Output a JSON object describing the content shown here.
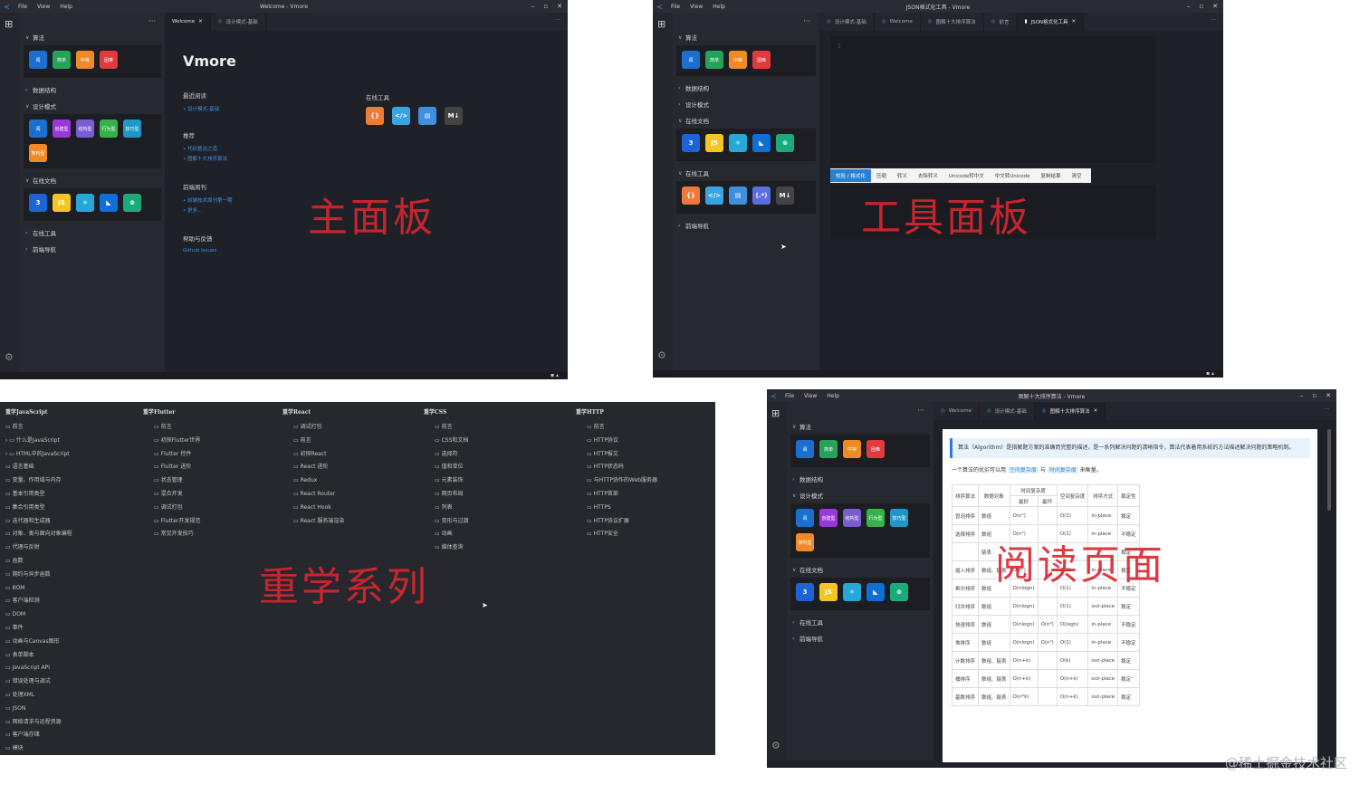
{
  "sidebar": {
    "sections": {
      "algo": "算法",
      "ds": "数据结构",
      "design": "设计模式",
      "docs": "在线文档",
      "tools": "在线工具",
      "nav": "前端导航"
    }
  },
  "algo_icons": [
    {
      "label": "阅",
      "color": "#1a6fcf"
    },
    {
      "label": "简单",
      "color": "#25a35a"
    },
    {
      "label": "中等",
      "color": "#f08a24"
    },
    {
      "label": "困难",
      "color": "#e0393e"
    }
  ],
  "design_icons": [
    {
      "label": "阅",
      "color": "#1a6fcf"
    },
    {
      "label": "创建型",
      "color": "#9b38d9"
    },
    {
      "label": "结构型",
      "color": "#7a5bd0"
    },
    {
      "label": "行为型",
      "color": "#35b34a"
    },
    {
      "label": "技巧型",
      "color": "#2196c9"
    },
    {
      "label": "架构型",
      "color": "#f08a24"
    }
  ],
  "doc_icons": [
    {
      "label": "css3-icon",
      "glyph": "3",
      "color": "#1d63d8"
    },
    {
      "label": "js-icon",
      "glyph": "JS",
      "color": "#f3c623"
    },
    {
      "label": "react-icon",
      "glyph": "⚛",
      "color": "#23a8d8"
    },
    {
      "label": "flutter-icon",
      "glyph": "◣",
      "color": "#0f6fd6"
    },
    {
      "label": "vue-icon",
      "glyph": "⊚",
      "color": "#1bab7a"
    }
  ],
  "tool_icons": [
    {
      "label": "json-icon",
      "glyph": "{}",
      "color": "#f07a3a"
    },
    {
      "label": "code-icon",
      "glyph": "</>",
      "color": "#3aa3e0"
    },
    {
      "label": "doc-icon",
      "glyph": "▤",
      "color": "#3d8fe0"
    },
    {
      "label": "regex-icon",
      "glyph": "(.*)",
      "color": "#5a6ee0"
    },
    {
      "label": "markdown-icon",
      "glyph": "M↓",
      "color": "#444"
    }
  ],
  "win1": {
    "title": "Welcome - Vmore",
    "menu": [
      "File",
      "View",
      "Help"
    ],
    "tabs": [
      "Welcome",
      "设计模式-基础"
    ],
    "app_name": "Vmore",
    "recent_title": "最近阅读",
    "recent": [
      "设计模式-基础"
    ],
    "recommend_title": "推荐",
    "recommend": [
      "代码整洁之道",
      "图解十大排序算法"
    ],
    "periodical_title": "前端周刊",
    "periodical": [
      "前端技术周刊第一期",
      "更多..."
    ],
    "help_title": "帮助与反馈",
    "help": [
      "Github Issues"
    ],
    "tools_title": "在线工具",
    "stamp": "主面板"
  },
  "win2": {
    "title": "JSON格式化工具 - Vmore",
    "tabs": [
      "设计模式-基础",
      "Welcome",
      "图解十大排序算法",
      "前言",
      "JSON格式化工具"
    ],
    "line_no": "1",
    "toolbar": [
      "校验 / 格式化",
      "压缩",
      "转义",
      "去除转义",
      "Unicode转中文",
      "中文转Unicode",
      "复制结果",
      "清空"
    ],
    "stamp": "工具面板"
  },
  "win3": {
    "stamp": "重学系列",
    "columns": [
      {
        "title": "重学JavaScript",
        "items": [
          "前言",
          "什么是JavaScript",
          "HTML中的JavaScript",
          "语言基础",
          "变量、作用域与内存",
          "基本引用类型",
          "集合引用类型",
          "迭代器和生成器",
          "对象、类与面向对象编程",
          "代理与反射",
          "函数",
          "期约与异步函数",
          "BOM",
          "客户端检测",
          "DOM",
          "事件",
          "动画与Canvas图形",
          "表单脚本",
          "JavaScript API",
          "错误处理与调试",
          "处理XML",
          "JSON",
          "网络请求与远程资源",
          "客户端存储",
          "模块"
        ]
      },
      {
        "title": "重学Flutter",
        "items": [
          "前言",
          "初探Flutter世界",
          "Flutter 控件",
          "Flutter 进阶",
          "状态管理",
          "混合开发",
          "调试打包",
          "Flutter开发规范",
          "常见开发技巧"
        ]
      },
      {
        "title": "重学React",
        "items": [
          "调试打包",
          "前言",
          "初探React",
          "React 进阶",
          "Redux",
          "React Router",
          "React Hook",
          "React 服务端渲染"
        ]
      },
      {
        "title": "重学CSS",
        "items": [
          "前言",
          "CSS和文档",
          "选择符",
          "值和单位",
          "元素装饰",
          "网页布局",
          "列表",
          "变形与过渡",
          "动画",
          "媒体查询"
        ]
      },
      {
        "title": "重学HTTP",
        "items": [
          "前言",
          "HTTP协议",
          "HTTP报文",
          "HTTP状态码",
          "与HTTP协作的Web服务器",
          "HTTP首部",
          "HTTPS",
          "HTTP协议扩展",
          "HTTP安全"
        ]
      }
    ]
  },
  "win4": {
    "title": "图解十大排序算法 - Vmore",
    "tabs": [
      "Welcome",
      "设计模式-基础",
      "图解十大排序算法"
    ],
    "intro": "算法（Algorithm）是指解题方案的准确而完整的描述，是一系列解决问题的清晰指令，算法代表着用系统的方法描述解决问题的策略机制。",
    "p_pre": "一个算法的优劣可以用",
    "p_link1": "空间复杂度",
    "p_mid": "与",
    "p_link2": "时间复杂度",
    "p_post": "来衡量。",
    "th": [
      "排序算法",
      "数据对象",
      "时间复杂度",
      "空间复杂度",
      "排序方式",
      "稳定性"
    ],
    "th_sub": [
      "最好",
      "最坏"
    ],
    "rows": [
      [
        "冒泡排序",
        "数组",
        "O(n²)",
        "",
        "O(1)",
        "in-place",
        "稳定"
      ],
      [
        "选择排序",
        "数组",
        "O(n²)",
        "",
        "O(1)",
        "in-place",
        "不稳定"
      ],
      [
        "",
        "链表",
        "",
        "",
        "",
        "",
        "稳定"
      ],
      [
        "插入排序",
        "数组、链表",
        "O(n²)",
        "",
        "O(1)",
        "in-place",
        "稳定"
      ],
      [
        "希尔排序",
        "数组",
        "O(nlogn)",
        "",
        "O(1)",
        "in-place",
        "不稳定"
      ],
      [
        "归并排序",
        "数组",
        "O(nlogn)",
        "",
        "O(1)",
        "out-place",
        "稳定"
      ],
      [
        "快速排序",
        "数组",
        "O(nlogn)",
        "O(n²)",
        "O(logn)",
        "in-place",
        "不稳定"
      ],
      [
        "堆排序",
        "数组",
        "O(nlogn)",
        "O(n²)",
        "O(1)",
        "in-place",
        "不稳定"
      ],
      [
        "计数排序",
        "数组、链表",
        "O(n+k)",
        "",
        "O(k)",
        "out-place",
        "稳定"
      ],
      [
        "桶排序",
        "数组、链表",
        "O(n+k)",
        "",
        "O(n+k)",
        "out-place",
        "稳定"
      ],
      [
        "基数排序",
        "数组、链表",
        "O(n*k)",
        "",
        "O(n+k)",
        "out-place",
        "稳定"
      ]
    ],
    "stamp": "阅读页面"
  },
  "watermark": "@稀土掘金技术社区"
}
